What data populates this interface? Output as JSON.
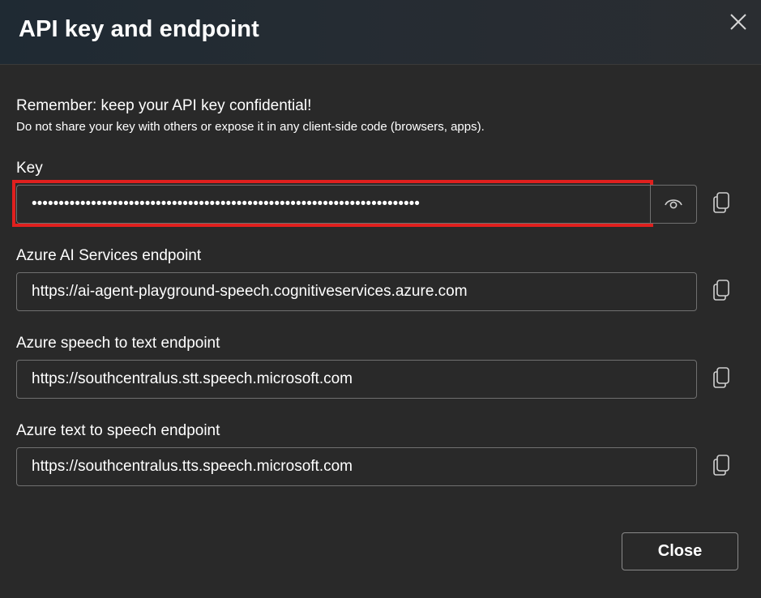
{
  "dialog": {
    "title": "API key and endpoint",
    "close_icon": "close-icon"
  },
  "warning": {
    "title": "Remember: keep your API key confidential!",
    "subtitle": "Do not share your key with others or expose it in any client-side code (browsers, apps)."
  },
  "key": {
    "label": "Key",
    "masked_value": "••••••••••••••••••••••••••••••••••••••••••••••••••••••••••••••••••••••••",
    "reveal_icon": "eye-icon",
    "copy_icon": "copy-icon",
    "highlight_color": "#e0201e"
  },
  "endpoints": [
    {
      "label": "Azure AI Services endpoint",
      "value": "https://ai-agent-playground-speech.cognitiveservices.azure.com"
    },
    {
      "label": "Azure speech to text endpoint",
      "value": "https://southcentralus.stt.speech.microsoft.com"
    },
    {
      "label": "Azure text to speech endpoint",
      "value": "https://southcentralus.tts.speech.microsoft.com"
    }
  ],
  "footer": {
    "close_label": "Close"
  }
}
